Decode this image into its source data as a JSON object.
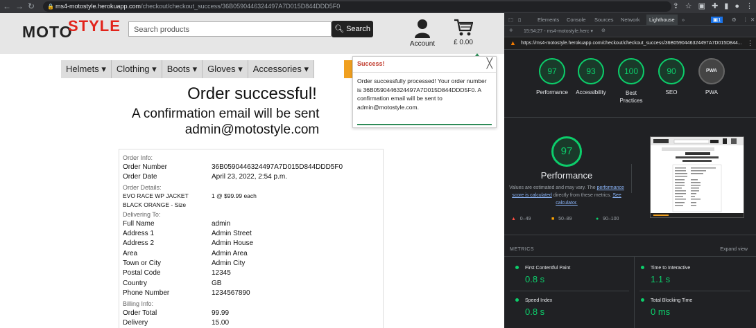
{
  "browser": {
    "url_host": "ms4-motostyle.herokuapp.com",
    "url_path": "/checkout/checkout_success/36B0590446324497A7D015D844DDD5F0"
  },
  "site": {
    "logo_part1": "MOTO",
    "logo_part2": "STYLE",
    "search_placeholder": "Search products",
    "search_button": "Search",
    "account_label": "Account",
    "bag_total": "£ 0.00",
    "nav": [
      "Helmets",
      "Clothing",
      "Boots",
      "Gloves",
      "Accessories"
    ],
    "heading": "Order successful!",
    "subheading_line1": "A confirmation email will be sent",
    "subheading_line2": "admin@motostyle.com"
  },
  "toast": {
    "title": "Success!",
    "close": "╳",
    "message": "Order successfully processed! Your order number is 36B0590446324497A7D015D844DDD5F0. A confirmation email will be sent to admin@motostyle.com."
  },
  "order": {
    "section_info": "Order Info:",
    "rows_info": [
      {
        "k": "Order Number",
        "v": "36B0590446324497A7D015D844DDD5F0"
      },
      {
        "k": "Order Date",
        "v": "April 23, 2022, 2:54 p.m."
      }
    ],
    "section_details": "Order Details:",
    "item_name_line1": "EVO RACE WP JACKET",
    "item_name_line2": "BLACK ORANGE - Size",
    "item_qty": "1 @ $99.99 each",
    "section_delivering": "Delivering To:",
    "rows_delivery": [
      {
        "k": "Full Name",
        "v": "admin"
      },
      {
        "k": "Address 1",
        "v": "Admin Street"
      },
      {
        "k": "Address 2",
        "v": "Admin House"
      },
      {
        "k": "Area",
        "v": "Admin Area"
      },
      {
        "k": "Town or City",
        "v": "Admin City"
      },
      {
        "k": "Postal Code",
        "v": "12345"
      },
      {
        "k": "Country",
        "v": "GB"
      },
      {
        "k": "Phone Number",
        "v": "1234567890"
      }
    ],
    "section_billing": "Billing Info:",
    "rows_billing": [
      {
        "k": "Order Total",
        "v": "99.99"
      },
      {
        "k": "Delivery",
        "v": "15.00"
      }
    ]
  },
  "devtools": {
    "tabs": [
      "Elements",
      "Console",
      "Sources",
      "Network",
      "Lighthouse"
    ],
    "active_tab": "Lighthouse",
    "badge": "1",
    "report_select": "15:54:27 - ms4-motostyle.herc",
    "report_url": "https://ms4-motostyle.herokuapp.com/checkout/checkout_success/36B0590446324497A7D015D844...",
    "gauges": [
      {
        "score": "97",
        "label": "Performance"
      },
      {
        "score": "93",
        "label": "Accessibility"
      },
      {
        "score": "100",
        "label": "Best Practices"
      },
      {
        "score": "90",
        "label": "SEO"
      },
      {
        "score": "PWA",
        "label": "PWA"
      }
    ],
    "perf_score": "97",
    "perf_title": "Performance",
    "perf_desc1": "Values are estimated and may vary. The",
    "perf_desc_link1": "performance score is calculated",
    "perf_desc2": "directly from these metrics.",
    "perf_desc_link2": "See calculator.",
    "legend": [
      "0–49",
      "50–89",
      "90–100"
    ],
    "metrics_header": "METRICS",
    "expand": "Expand view",
    "metrics": [
      {
        "name": "First Contentful Paint",
        "value": "0.8 s"
      },
      {
        "name": "Time to Interactive",
        "value": "1.1 s"
      },
      {
        "name": "Speed Index",
        "value": "0.8 s"
      },
      {
        "name": "Total Blocking Time",
        "value": "0 ms"
      }
    ]
  }
}
